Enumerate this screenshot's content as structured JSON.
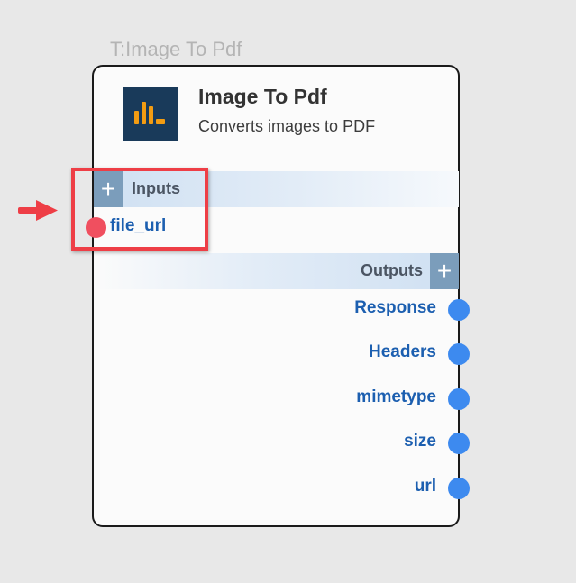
{
  "node": {
    "type_label": "T:Image To Pdf",
    "title": "Image To Pdf",
    "description": "Converts images to PDF",
    "icon": "bar-chart-icon",
    "inputs_label": "Inputs",
    "outputs_label": "Outputs",
    "add_symbol": "+",
    "inputs": [
      {
        "label": "file_url"
      }
    ],
    "outputs": [
      {
        "label": "Response"
      },
      {
        "label": "Headers"
      },
      {
        "label": "mimetype"
      },
      {
        "label": "size"
      },
      {
        "label": "url"
      }
    ]
  },
  "colors": {
    "icon_bg": "#193a5a",
    "icon_bars": "#f39c12",
    "input_port": "#f04f5f",
    "output_port": "#3d8aef",
    "port_label": "#1c5fb0",
    "highlight": "#ee3e46"
  }
}
